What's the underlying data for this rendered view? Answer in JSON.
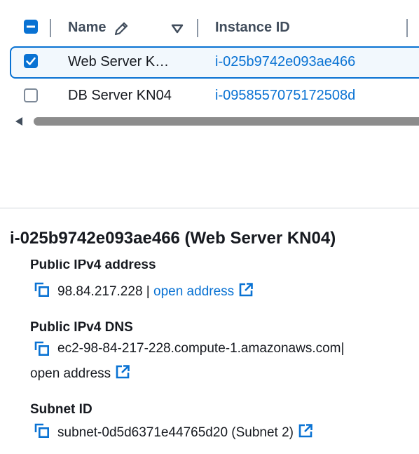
{
  "table": {
    "columns": {
      "name": "Name",
      "instance_id": "Instance ID"
    },
    "rows": [
      {
        "name": "Web Server K…",
        "instance_id": "i-025b9742e093ae466",
        "selected": true
      },
      {
        "name": "DB Server KN04",
        "instance_id": "i-0958557075172508d",
        "selected": false
      }
    ]
  },
  "details": {
    "title": "i-025b9742e093ae466 (Web Server KN04)",
    "public_ipv4": {
      "label": "Public IPv4 address",
      "value": "98.84.217.228",
      "separator": "|",
      "link": "open address"
    },
    "public_dns": {
      "label": "Public IPv4 DNS",
      "value": "ec2-98-84-217-228.compute-1.amazonaws.com",
      "separator": "|",
      "link": "open address"
    },
    "subnet": {
      "label": "Subnet ID",
      "value": "subnet-0d5d6371e44765d20 (Subnet 2)"
    }
  },
  "colors": {
    "accent": "#0972d3",
    "text": "#16191f",
    "header": "#414d5c"
  },
  "icons": [
    "indeterminate-checkbox-icon",
    "edit-pencil-icon",
    "sort-caret-icon",
    "checkbox-checked-icon",
    "checkbox-unchecked-icon",
    "copy-icon",
    "external-link-icon"
  ]
}
